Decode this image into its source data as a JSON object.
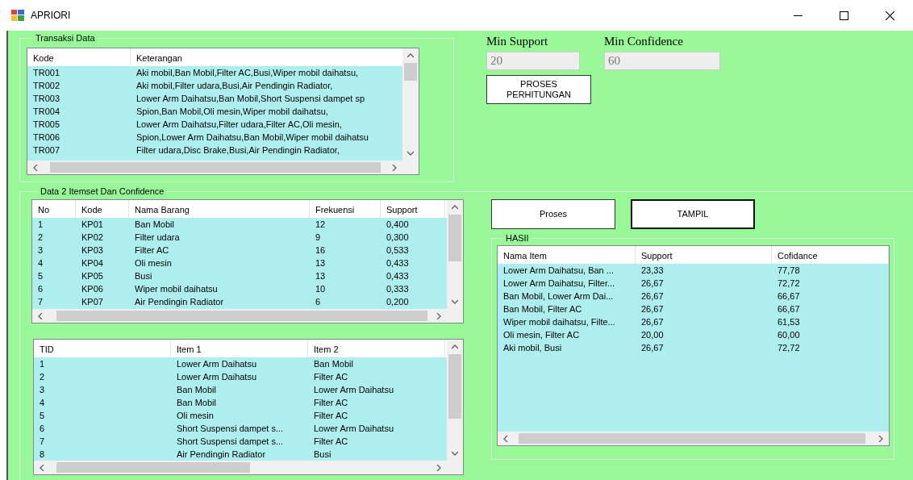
{
  "window": {
    "title": "APRIORI"
  },
  "transaksi": {
    "title": "Transaksi Data",
    "table": {
      "columns": [
        "Kode",
        "Keterangan"
      ],
      "rows": [
        [
          "TR001",
          "Aki mobil,Ban Mobil,Filter AC,Busi,Wiper mobil daihatsu,"
        ],
        [
          "TR002",
          "Aki mobil,Filter udara,Busi,Air Pendingin Radiator,"
        ],
        [
          "TR003",
          "Lower Arm Daihatsu,Ban Mobil,Short Suspensi dampet sp"
        ],
        [
          "TR004",
          "Spion,Ban Mobil,Oli mesin,Wiper mobil daihatsu,"
        ],
        [
          "TR005",
          "Lower Arm Daihatsu,Filter udara,Filter AC,Oli mesin,"
        ],
        [
          "TR006",
          "Spion,Lower Arm Daihatsu,Ban Mobil,Wiper mobil daihatsu"
        ],
        [
          "TR007",
          "Filter udara,Disc Brake,Busi,Air Pendingin Radiator,"
        ]
      ]
    }
  },
  "params": {
    "fields": [
      {
        "label": "Min Support",
        "value": "20",
        "disabled": true
      },
      {
        "label": "Min Confidence",
        "value": "60",
        "disabled": true
      }
    ],
    "button": "PROSES PERHITUNGAN"
  },
  "itemset": {
    "title": "Data 2 Itemset Dan Confidence",
    "items_table": {
      "columns": [
        "No",
        "Kode",
        "Nama Barang",
        "Frekuensi",
        "Support"
      ],
      "rows": [
        [
          "1",
          "KP01",
          "Ban Mobil",
          "12",
          "0,400"
        ],
        [
          "2",
          "KP02",
          "Filter udara",
          "9",
          "0,300"
        ],
        [
          "3",
          "KP03",
          "Filter AC",
          "16",
          "0,533"
        ],
        [
          "4",
          "KP04",
          "Oli mesin",
          "13",
          "0,433"
        ],
        [
          "5",
          "KP05",
          "Busi",
          "13",
          "0,433"
        ],
        [
          "6",
          "KP06",
          "Wiper mobil daihatsu",
          "10",
          "0,333"
        ],
        [
          "7",
          "KP07",
          "Air Pendingin Radiator",
          "6",
          "0,200"
        ]
      ]
    },
    "pairs_table": {
      "columns": [
        "TID",
        "Item 1",
        "Item 2"
      ],
      "rows": [
        [
          "1",
          "Lower Arm Daihatsu",
          "Ban Mobil"
        ],
        [
          "2",
          "Lower Arm Daihatsu",
          "Filter AC"
        ],
        [
          "3",
          "Ban Mobil",
          "Lower Arm Daihatsu"
        ],
        [
          "4",
          "Ban Mobil",
          "Filter AC"
        ],
        [
          "5",
          "Oli mesin",
          "Filter AC"
        ],
        [
          "6",
          "Short Suspensi dampet s...",
          "Lower Arm Daihatsu"
        ],
        [
          "7",
          "Short Suspensi dampet s...",
          "Filter AC"
        ],
        [
          "8",
          "Air Pendingin Radiator",
          "Busi"
        ]
      ]
    },
    "buttons": [
      {
        "label": "Proses",
        "default": false
      },
      {
        "label": "TAMPIL",
        "default": true
      }
    ],
    "hasil": {
      "title": "HASIl",
      "table": {
        "columns": [
          "Nama Item",
          "Support",
          "Cofidance"
        ],
        "rows": [
          [
            "Lower Arm Daihatsu, Ban ...",
            "23,33",
            "77,78"
          ],
          [
            "Lower Arm Daihatsu, Filter...",
            "26,67",
            "72,72"
          ],
          [
            "Ban Mobil, Lower Arm Dai...",
            "26,67",
            "66,67"
          ],
          [
            "Ban Mobil, Filter AC",
            "26,67",
            "66,67"
          ],
          [
            "Wiper mobil daihatsu, Filte...",
            "26,67",
            "61,53"
          ],
          [
            "Oli mesin, Filter AC",
            "20,00",
            "60,00"
          ],
          [
            "Aki mobil, Busi",
            "26,67",
            "72,72"
          ]
        ]
      }
    }
  }
}
